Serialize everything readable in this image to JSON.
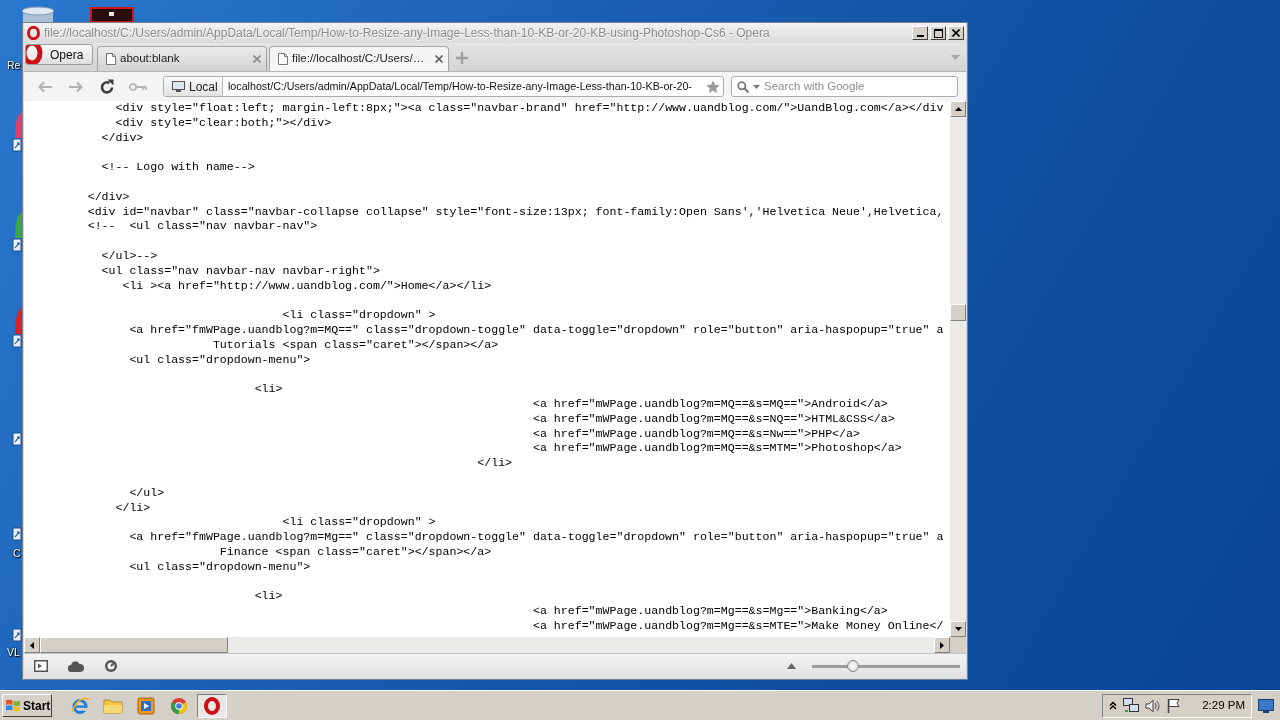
{
  "desktop": {
    "icon_labels": [
      "Re",
      "C",
      "VL"
    ]
  },
  "window": {
    "title": "file://localhost/C:/Users/admin/AppData/Local/Temp/How-to-Resize-any-Image-Less-than-10-KB-or-20-KB-using-Photoshop-Cs6 - Opera"
  },
  "menu_button": {
    "label": "Opera"
  },
  "tabs": [
    {
      "label": "about:blank",
      "selected": false
    },
    {
      "label": "file://localhost/C:/Users/…",
      "selected": true
    }
  ],
  "toolbar": {
    "buttons": [
      {
        "kind": "back",
        "disabled": true
      },
      {
        "kind": "forward",
        "disabled": true
      },
      {
        "kind": "reload",
        "disabled": false
      },
      {
        "kind": "key",
        "disabled": true
      }
    ],
    "location_badge": "Local",
    "address": "localhost/C:/Users/admin/AppData/Local/Temp/How-to-Resize-any-Image-Less-than-10-KB-or-20-",
    "search": {
      "placeholder": "Search with Google"
    }
  },
  "source_view": {
    "blocks": [
      [
        "            <div style=\"float:left; margin-left:8px;\"><a class=\"navbar-brand\" href=\"http://www.uandblog.com/\">UandBlog.com</a></div",
        "            <div style=\"clear:both;\"></div>",
        "          </div>"
      ],
      [
        "          <!-- Logo with name-->"
      ],
      [
        "        </div>",
        "        <div id=\"navbar\" class=\"navbar-collapse collapse\" style=\"font-size:13px; font-family:Open Sans','Helvetica Neue',Helvetica,",
        "        <!--  <ul class=\"nav navbar-nav\">"
      ],
      [
        "          </ul>-->",
        "          <ul class=\"nav navbar-nav navbar-right\">",
        "             <li ><a href=\"http://www.uandblog.com/\">Home</a></li>"
      ],
      [
        "                                    <li class=\"dropdown\" >",
        "              <a href=\"fmWPage.uandblog?m=MQ==\" class=\"dropdown-toggle\" data-toggle=\"dropdown\" role=\"button\" aria-haspopup=\"true\" a",
        "                          Tutorials <span class=\"caret\"></span></a>",
        "              <ul class=\"dropdown-menu\">"
      ],
      [
        "                                <li>",
        "                                                                        <a href=\"mWPage.uandblog?m=MQ==&s=MQ==\">Android</a>",
        "                                                                        <a href=\"mWPage.uandblog?m=MQ==&s=NQ==\">HTML&CSS</a>",
        "                                                                        <a href=\"mWPage.uandblog?m=MQ==&s=Nw==\">PHP</a>",
        "                                                                        <a href=\"mWPage.uandblog?m=MQ==&s=MTM=\">Photoshop</a>",
        "                                                                </li>"
      ],
      [
        "              </ul>",
        "            </li>",
        "                                    <li class=\"dropdown\" >",
        "              <a href=\"fmWPage.uandblog?m=Mg==\" class=\"dropdown-toggle\" data-toggle=\"dropdown\" role=\"button\" aria-haspopup=\"true\" a",
        "                           Finance <span class=\"caret\"></span></a>",
        "              <ul class=\"dropdown-menu\">"
      ],
      [
        "                                <li>",
        "                                                                        <a href=\"mWPage.uandblog?m=Mg==&s=Mg==\">Banking</a>",
        "                                                                        <a href=\"mWPage.uandblog?m=Mg==&s=MTE=\">Make Money Online</"
      ]
    ]
  },
  "status_bar": {
    "zoom": {
      "level": 0.28
    }
  },
  "taskbar": {
    "start": "Start",
    "apps": [
      {
        "kind": "ie",
        "selected": false
      },
      {
        "kind": "folder",
        "selected": false
      },
      {
        "kind": "media",
        "selected": false
      },
      {
        "kind": "chrome",
        "selected": false
      },
      {
        "kind": "opera",
        "selected": true
      }
    ],
    "clock": "2:29 PM"
  }
}
